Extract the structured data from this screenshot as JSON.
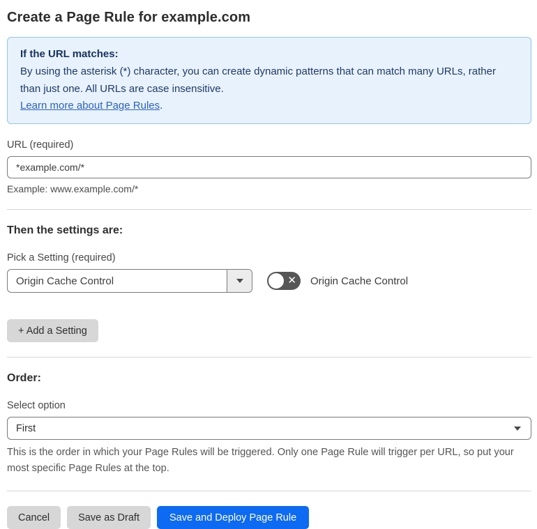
{
  "page": {
    "title": "Create a Page Rule for example.com"
  },
  "info_box": {
    "heading": "If the URL matches:",
    "body": "By using the asterisk (*) character, you can create dynamic patterns that can match many URLs, rather than just one. All URLs are case insensitive.",
    "link": "Learn more about Page Rules",
    "link_suffix": "."
  },
  "url_field": {
    "label": "URL (required)",
    "value": "*example.com/*",
    "hint": "Example: www.example.com/*"
  },
  "settings_section": {
    "heading": "Then the settings are:",
    "picker_label": "Pick a Setting (required)",
    "picker_value": "Origin Cache Control",
    "toggle_label": "Origin Cache Control",
    "toggle_state": "off",
    "toggle_glyph": "✕",
    "add_button": "+ Add a Setting"
  },
  "order_section": {
    "heading": "Order:",
    "select_label": "Select option",
    "select_value": "First",
    "description": "This is the order in which your Page Rules will be triggered. Only one Page Rule will trigger per URL, so put your most specific Page Rules at the top."
  },
  "actions": {
    "cancel": "Cancel",
    "save_draft": "Save as Draft",
    "save_deploy": "Save and Deploy Page Rule"
  },
  "colors": {
    "info_bg": "#e8f2fc",
    "info_border": "#93c3ea",
    "info_text": "#1e3a68",
    "link_blue": "#2a62c4",
    "primary_button": "#0d6af2",
    "gray_button": "#d7d7d7",
    "toggle_off": "#565656",
    "divider": "#d8d8d8"
  }
}
